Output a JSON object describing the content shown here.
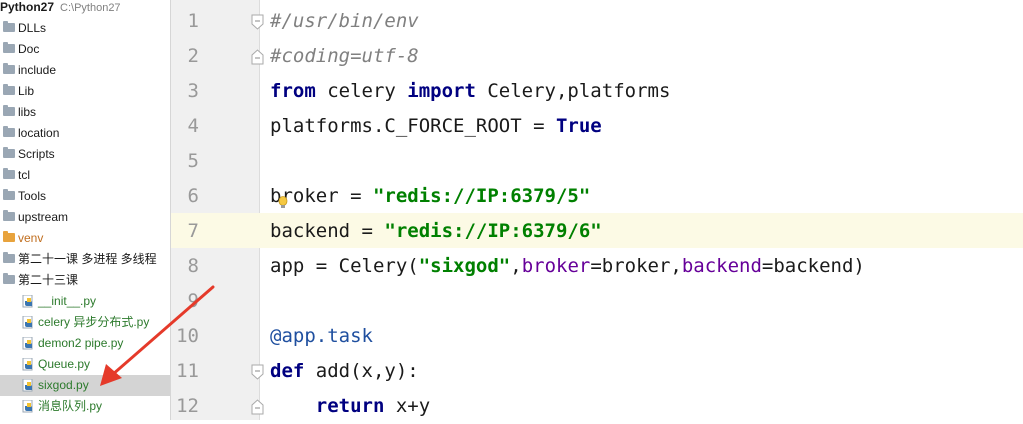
{
  "project": {
    "root_name": "Python27",
    "root_path": "C:\\Python27",
    "folders": [
      {
        "label": "DLLs"
      },
      {
        "label": "Doc"
      },
      {
        "label": "include"
      },
      {
        "label": "Lib"
      },
      {
        "label": "libs"
      },
      {
        "label": "location"
      },
      {
        "label": "Scripts"
      },
      {
        "label": "tcl"
      },
      {
        "label": "Tools"
      },
      {
        "label": "upstream"
      }
    ],
    "venv": "venv",
    "lesson21": "第二十一课 多进程 多线程",
    "lesson23": "第二十三课",
    "files": [
      {
        "label": "__init__.py"
      },
      {
        "label": "celery 异步分布式.py"
      },
      {
        "label": "demon2 pipe.py"
      },
      {
        "label": "Queue.py"
      },
      {
        "label": "sixgod.py"
      },
      {
        "label": "消息队列.py"
      }
    ]
  },
  "editor": {
    "line_numbers": [
      "1",
      "2",
      "3",
      "4",
      "5",
      "6",
      "7",
      "8",
      "9",
      "10",
      "11",
      "12"
    ],
    "current_line": 7,
    "code": {
      "l1": "#/usr/bin/env",
      "l2": "#coding=utf-8",
      "l3_from": "from",
      "l3_mid": " celery ",
      "l3_import": "import",
      "l3_rest": " Celery,platforms",
      "l4_a": "platforms.C_FORCE_ROOT = ",
      "l4_true": "True",
      "l6_a": "broker = ",
      "l6_str": "\"redis://IP:6379/5\"",
      "l7_a": "backend = ",
      "l7_str": "\"redis://IP:6379/6\"",
      "l8_a": "app = Celery(",
      "l8_str": "\"sixgod\"",
      "l8_b": ",",
      "l8_kw1": "broker",
      "l8_c": "=broker,",
      "l8_kw2": "backend",
      "l8_d": "=backend)",
      "l10": "@app.task",
      "l11_def": "def",
      "l11_rest": " add(x,y):",
      "l12_indent": "    ",
      "l12_return": "return",
      "l12_rest": " x+y"
    }
  },
  "colors": {
    "keyword": "#000080",
    "string": "#008000",
    "comment": "#808080",
    "kwarg": "#660099",
    "annotation_arrow": "#e53a2a"
  }
}
